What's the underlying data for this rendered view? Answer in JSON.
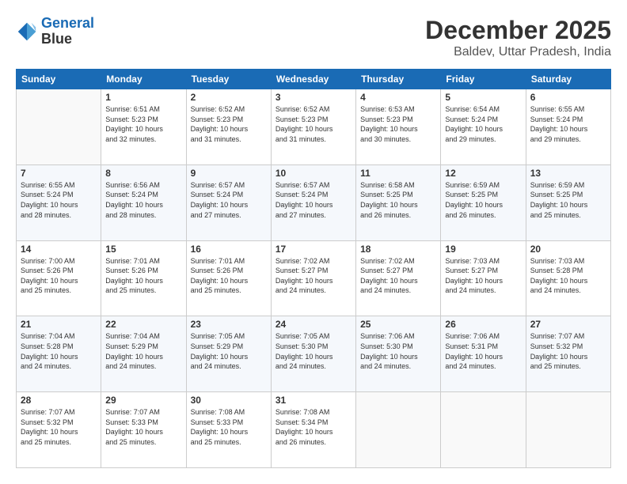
{
  "header": {
    "logo_line1": "General",
    "logo_line2": "Blue",
    "month_year": "December 2025",
    "location": "Baldev, Uttar Pradesh, India"
  },
  "weekdays": [
    "Sunday",
    "Monday",
    "Tuesday",
    "Wednesday",
    "Thursday",
    "Friday",
    "Saturday"
  ],
  "weeks": [
    [
      {
        "day": "",
        "info": ""
      },
      {
        "day": "1",
        "info": "Sunrise: 6:51 AM\nSunset: 5:23 PM\nDaylight: 10 hours\nand 32 minutes."
      },
      {
        "day": "2",
        "info": "Sunrise: 6:52 AM\nSunset: 5:23 PM\nDaylight: 10 hours\nand 31 minutes."
      },
      {
        "day": "3",
        "info": "Sunrise: 6:52 AM\nSunset: 5:23 PM\nDaylight: 10 hours\nand 31 minutes."
      },
      {
        "day": "4",
        "info": "Sunrise: 6:53 AM\nSunset: 5:23 PM\nDaylight: 10 hours\nand 30 minutes."
      },
      {
        "day": "5",
        "info": "Sunrise: 6:54 AM\nSunset: 5:24 PM\nDaylight: 10 hours\nand 29 minutes."
      },
      {
        "day": "6",
        "info": "Sunrise: 6:55 AM\nSunset: 5:24 PM\nDaylight: 10 hours\nand 29 minutes."
      }
    ],
    [
      {
        "day": "7",
        "info": "Sunrise: 6:55 AM\nSunset: 5:24 PM\nDaylight: 10 hours\nand 28 minutes."
      },
      {
        "day": "8",
        "info": "Sunrise: 6:56 AM\nSunset: 5:24 PM\nDaylight: 10 hours\nand 28 minutes."
      },
      {
        "day": "9",
        "info": "Sunrise: 6:57 AM\nSunset: 5:24 PM\nDaylight: 10 hours\nand 27 minutes."
      },
      {
        "day": "10",
        "info": "Sunrise: 6:57 AM\nSunset: 5:24 PM\nDaylight: 10 hours\nand 27 minutes."
      },
      {
        "day": "11",
        "info": "Sunrise: 6:58 AM\nSunset: 5:25 PM\nDaylight: 10 hours\nand 26 minutes."
      },
      {
        "day": "12",
        "info": "Sunrise: 6:59 AM\nSunset: 5:25 PM\nDaylight: 10 hours\nand 26 minutes."
      },
      {
        "day": "13",
        "info": "Sunrise: 6:59 AM\nSunset: 5:25 PM\nDaylight: 10 hours\nand 25 minutes."
      }
    ],
    [
      {
        "day": "14",
        "info": "Sunrise: 7:00 AM\nSunset: 5:26 PM\nDaylight: 10 hours\nand 25 minutes."
      },
      {
        "day": "15",
        "info": "Sunrise: 7:01 AM\nSunset: 5:26 PM\nDaylight: 10 hours\nand 25 minutes."
      },
      {
        "day": "16",
        "info": "Sunrise: 7:01 AM\nSunset: 5:26 PM\nDaylight: 10 hours\nand 25 minutes."
      },
      {
        "day": "17",
        "info": "Sunrise: 7:02 AM\nSunset: 5:27 PM\nDaylight: 10 hours\nand 24 minutes."
      },
      {
        "day": "18",
        "info": "Sunrise: 7:02 AM\nSunset: 5:27 PM\nDaylight: 10 hours\nand 24 minutes."
      },
      {
        "day": "19",
        "info": "Sunrise: 7:03 AM\nSunset: 5:27 PM\nDaylight: 10 hours\nand 24 minutes."
      },
      {
        "day": "20",
        "info": "Sunrise: 7:03 AM\nSunset: 5:28 PM\nDaylight: 10 hours\nand 24 minutes."
      }
    ],
    [
      {
        "day": "21",
        "info": "Sunrise: 7:04 AM\nSunset: 5:28 PM\nDaylight: 10 hours\nand 24 minutes."
      },
      {
        "day": "22",
        "info": "Sunrise: 7:04 AM\nSunset: 5:29 PM\nDaylight: 10 hours\nand 24 minutes."
      },
      {
        "day": "23",
        "info": "Sunrise: 7:05 AM\nSunset: 5:29 PM\nDaylight: 10 hours\nand 24 minutes."
      },
      {
        "day": "24",
        "info": "Sunrise: 7:05 AM\nSunset: 5:30 PM\nDaylight: 10 hours\nand 24 minutes."
      },
      {
        "day": "25",
        "info": "Sunrise: 7:06 AM\nSunset: 5:30 PM\nDaylight: 10 hours\nand 24 minutes."
      },
      {
        "day": "26",
        "info": "Sunrise: 7:06 AM\nSunset: 5:31 PM\nDaylight: 10 hours\nand 24 minutes."
      },
      {
        "day": "27",
        "info": "Sunrise: 7:07 AM\nSunset: 5:32 PM\nDaylight: 10 hours\nand 25 minutes."
      }
    ],
    [
      {
        "day": "28",
        "info": "Sunrise: 7:07 AM\nSunset: 5:32 PM\nDaylight: 10 hours\nand 25 minutes."
      },
      {
        "day": "29",
        "info": "Sunrise: 7:07 AM\nSunset: 5:33 PM\nDaylight: 10 hours\nand 25 minutes."
      },
      {
        "day": "30",
        "info": "Sunrise: 7:08 AM\nSunset: 5:33 PM\nDaylight: 10 hours\nand 25 minutes."
      },
      {
        "day": "31",
        "info": "Sunrise: 7:08 AM\nSunset: 5:34 PM\nDaylight: 10 hours\nand 26 minutes."
      },
      {
        "day": "",
        "info": ""
      },
      {
        "day": "",
        "info": ""
      },
      {
        "day": "",
        "info": ""
      }
    ]
  ]
}
